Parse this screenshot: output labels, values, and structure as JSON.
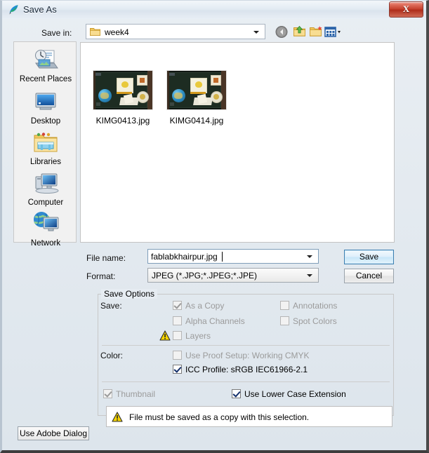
{
  "window": {
    "title": "Save As",
    "title_icon": "photoshop-feather-icon",
    "close_label": "X"
  },
  "toolbar": {
    "save_in_label": "Save in:",
    "save_in_value": "week4",
    "buttons": [
      {
        "name": "back-button",
        "icon": "back-arrow-icon"
      },
      {
        "name": "up-one-level-button",
        "icon": "up-folder-icon"
      },
      {
        "name": "create-new-folder-button",
        "icon": "new-folder-icon"
      },
      {
        "name": "views-button",
        "icon": "views-grid-icon"
      }
    ]
  },
  "places": [
    {
      "label": "Recent Places",
      "icon": "recent-places-icon"
    },
    {
      "label": "Desktop",
      "icon": "desktop-icon"
    },
    {
      "label": "Libraries",
      "icon": "libraries-icon"
    },
    {
      "label": "Computer",
      "icon": "computer-icon"
    },
    {
      "label": "Network",
      "icon": "network-icon"
    }
  ],
  "files": [
    {
      "name": "KIMG0413.jpg",
      "icon": "photo-thumbnail"
    },
    {
      "name": "KIMG0414.jpg",
      "icon": "photo-thumbnail"
    }
  ],
  "fields": {
    "file_name_label": "File name:",
    "file_name_value": "fablabkhairpur.jpg",
    "format_label": "Format:",
    "format_value": "JPEG (*.JPG;*.JPEG;*.JPE)"
  },
  "buttons": {
    "save": "Save",
    "cancel": "Cancel",
    "use_adobe_dialog": "Use Adobe Dialog"
  },
  "save_options": {
    "group_title": "Save Options",
    "save_label": "Save:",
    "color_label": "Color:",
    "checkboxes": {
      "as_a_copy": {
        "label": "As a Copy",
        "checked": true,
        "disabled": true
      },
      "annotations": {
        "label": "Annotations",
        "checked": false,
        "disabled": true
      },
      "alpha_channels": {
        "label": "Alpha Channels",
        "checked": false,
        "disabled": true
      },
      "spot_colors": {
        "label": "Spot Colors",
        "checked": false,
        "disabled": true
      },
      "layers": {
        "label": "Layers",
        "checked": false,
        "disabled": true,
        "warning": true
      },
      "use_proof_setup": {
        "label": "Use Proof Setup:  Working CMYK",
        "checked": false,
        "disabled": true
      },
      "icc_profile": {
        "label": "ICC Profile:  sRGB IEC61966-2.1",
        "checked": true,
        "disabled": false
      },
      "thumbnail": {
        "label": "Thumbnail",
        "checked": true,
        "disabled": true
      },
      "use_lower_case_extension": {
        "label": "Use Lower Case Extension",
        "checked": true,
        "disabled": false
      }
    }
  },
  "warning": {
    "icon": "warning-triangle-icon",
    "message": "File must be saved as a copy with this selection."
  },
  "colors": {
    "accent": "#3c7fb1",
    "close_red": "#c33c29",
    "warning_yellow": "#f5d400"
  }
}
